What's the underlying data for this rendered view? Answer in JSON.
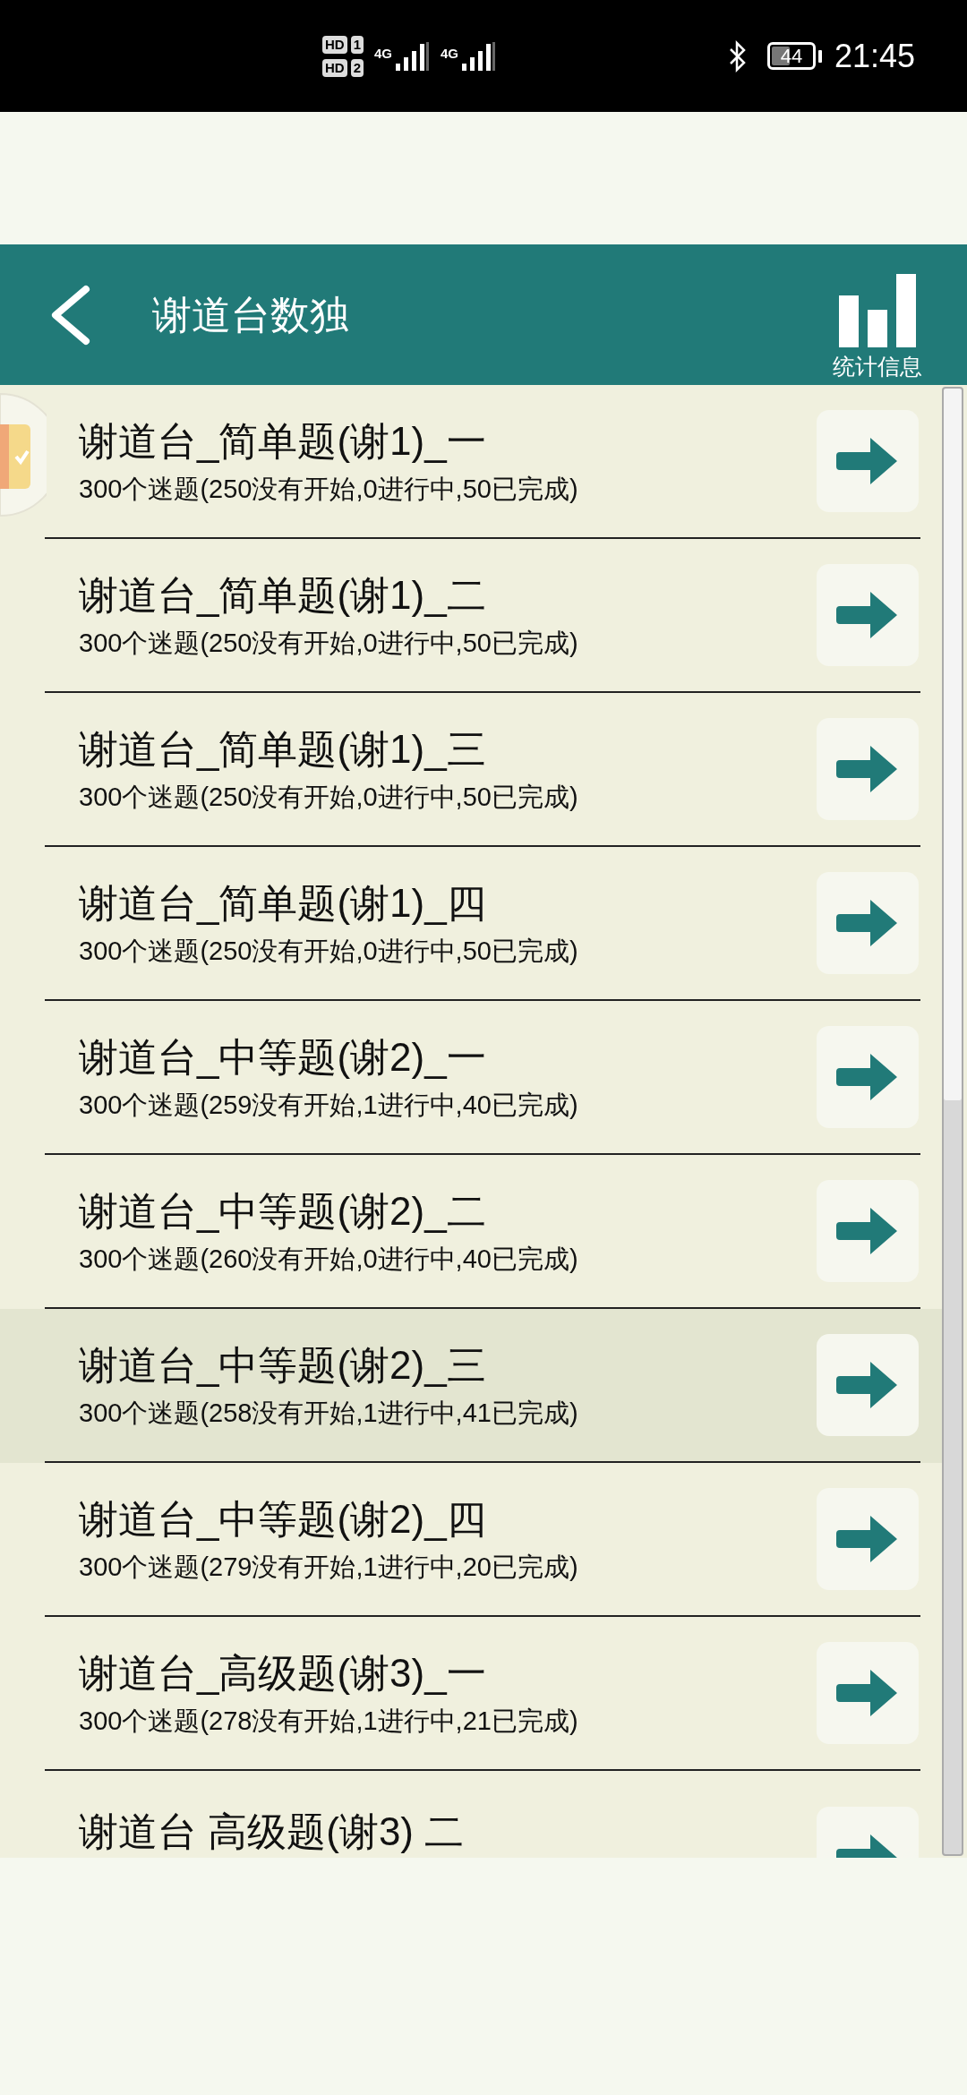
{
  "status_bar": {
    "sims": [
      {
        "label": "HD",
        "slot": "1"
      },
      {
        "label": "HD",
        "slot": "2"
      }
    ],
    "networks": [
      "4G",
      "4G"
    ],
    "battery": "44",
    "time": "21:45"
  },
  "header": {
    "title": "谢道台数独",
    "stats_label": "统计信息"
  },
  "puzzle_sets": [
    {
      "title": "谢道台_简单题(谢1)_一",
      "summary": "300个迷题(250没有开始,0进行中,50已完成)",
      "selected": false
    },
    {
      "title": "谢道台_简单题(谢1)_二",
      "summary": "300个迷题(250没有开始,0进行中,50已完成)",
      "selected": false
    },
    {
      "title": "谢道台_简单题(谢1)_三",
      "summary": "300个迷题(250没有开始,0进行中,50已完成)",
      "selected": false
    },
    {
      "title": "谢道台_简单题(谢1)_四",
      "summary": "300个迷题(250没有开始,0进行中,50已完成)",
      "selected": false
    },
    {
      "title": "谢道台_中等题(谢2)_一",
      "summary": "300个迷题(259没有开始,1进行中,40已完成)",
      "selected": false
    },
    {
      "title": "谢道台_中等题(谢2)_二",
      "summary": "300个迷题(260没有开始,0进行中,40已完成)",
      "selected": false
    },
    {
      "title": "谢道台_中等题(谢2)_三",
      "summary": "300个迷题(258没有开始,1进行中,41已完成)",
      "selected": true
    },
    {
      "title": "谢道台_中等题(谢2)_四",
      "summary": "300个迷题(279没有开始,1进行中,20已完成)",
      "selected": false
    },
    {
      "title": "谢道台_高级题(谢3)_一",
      "summary": "300个迷题(278没有开始,1进行中,21已完成)",
      "selected": false
    },
    {
      "title": "谢道台 高级题(谢3) 二",
      "selected": false
    }
  ]
}
